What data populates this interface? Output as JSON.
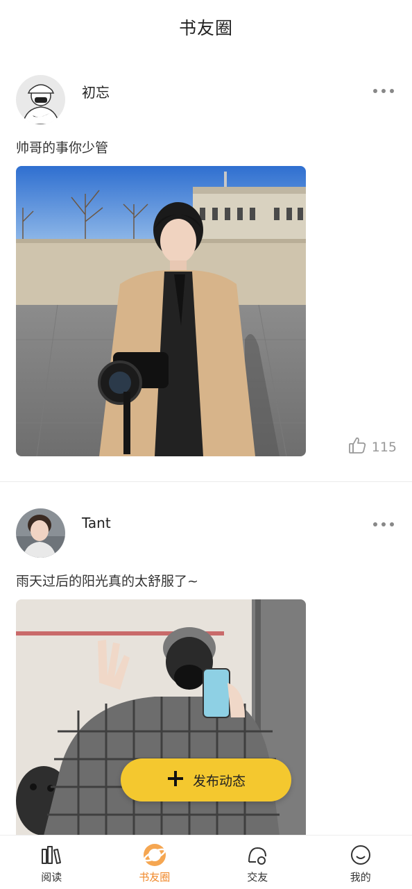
{
  "header": {
    "title": "书友圈"
  },
  "posts": [
    {
      "author": "初忘",
      "text": "帅哥的事你少管",
      "likes": "115"
    },
    {
      "author": "Tant",
      "text": "雨天过后的阳光真的太舒服了~"
    }
  ],
  "fab": {
    "label": "发布动态"
  },
  "tabs": [
    {
      "label": "阅读",
      "icon": "bookshelf-icon"
    },
    {
      "label": "书友圈",
      "icon": "planet-icon"
    },
    {
      "label": "交友",
      "icon": "friends-icon"
    },
    {
      "label": "我的",
      "icon": "smiley-icon"
    }
  ],
  "colors": {
    "accent": "#f4c82f",
    "active_tab": "#f0882a"
  }
}
